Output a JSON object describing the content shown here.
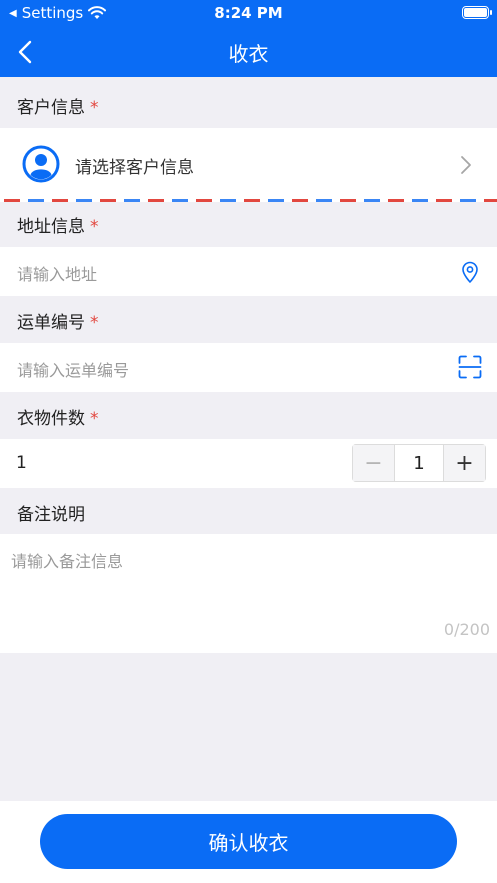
{
  "status": {
    "carrier": "Settings",
    "time": "8:24 PM"
  },
  "nav": {
    "title": "收衣"
  },
  "customer": {
    "label": "客户信息",
    "required_mark": "*",
    "placeholder": "请选择客户信息"
  },
  "address": {
    "label": "地址信息",
    "required_mark": "*",
    "placeholder": "请输入地址"
  },
  "waybill": {
    "label": "运单编号",
    "required_mark": "*",
    "placeholder": "请输入运单编号"
  },
  "quantity": {
    "label": "衣物件数",
    "required_mark": "*",
    "value": "1",
    "stepper_value": "1",
    "minus": "−",
    "plus": "+"
  },
  "notes": {
    "label": "备注说明",
    "placeholder": "请输入备注信息",
    "counter": "0/200"
  },
  "footer": {
    "confirm_label": "确认收衣"
  },
  "colors": {
    "primary": "#0a6cf5",
    "required": "#e2473f",
    "background": "#f0eff4",
    "envelope_red": "#e2473f",
    "envelope_blue": "#3a86f5"
  },
  "icons": {
    "back": "chevron-left-icon",
    "avatar": "user-avatar-icon",
    "chevron": "chevron-right-icon",
    "location": "location-pin-icon",
    "scan": "scan-icon",
    "wifi": "wifi-icon",
    "battery": "battery-icon"
  }
}
